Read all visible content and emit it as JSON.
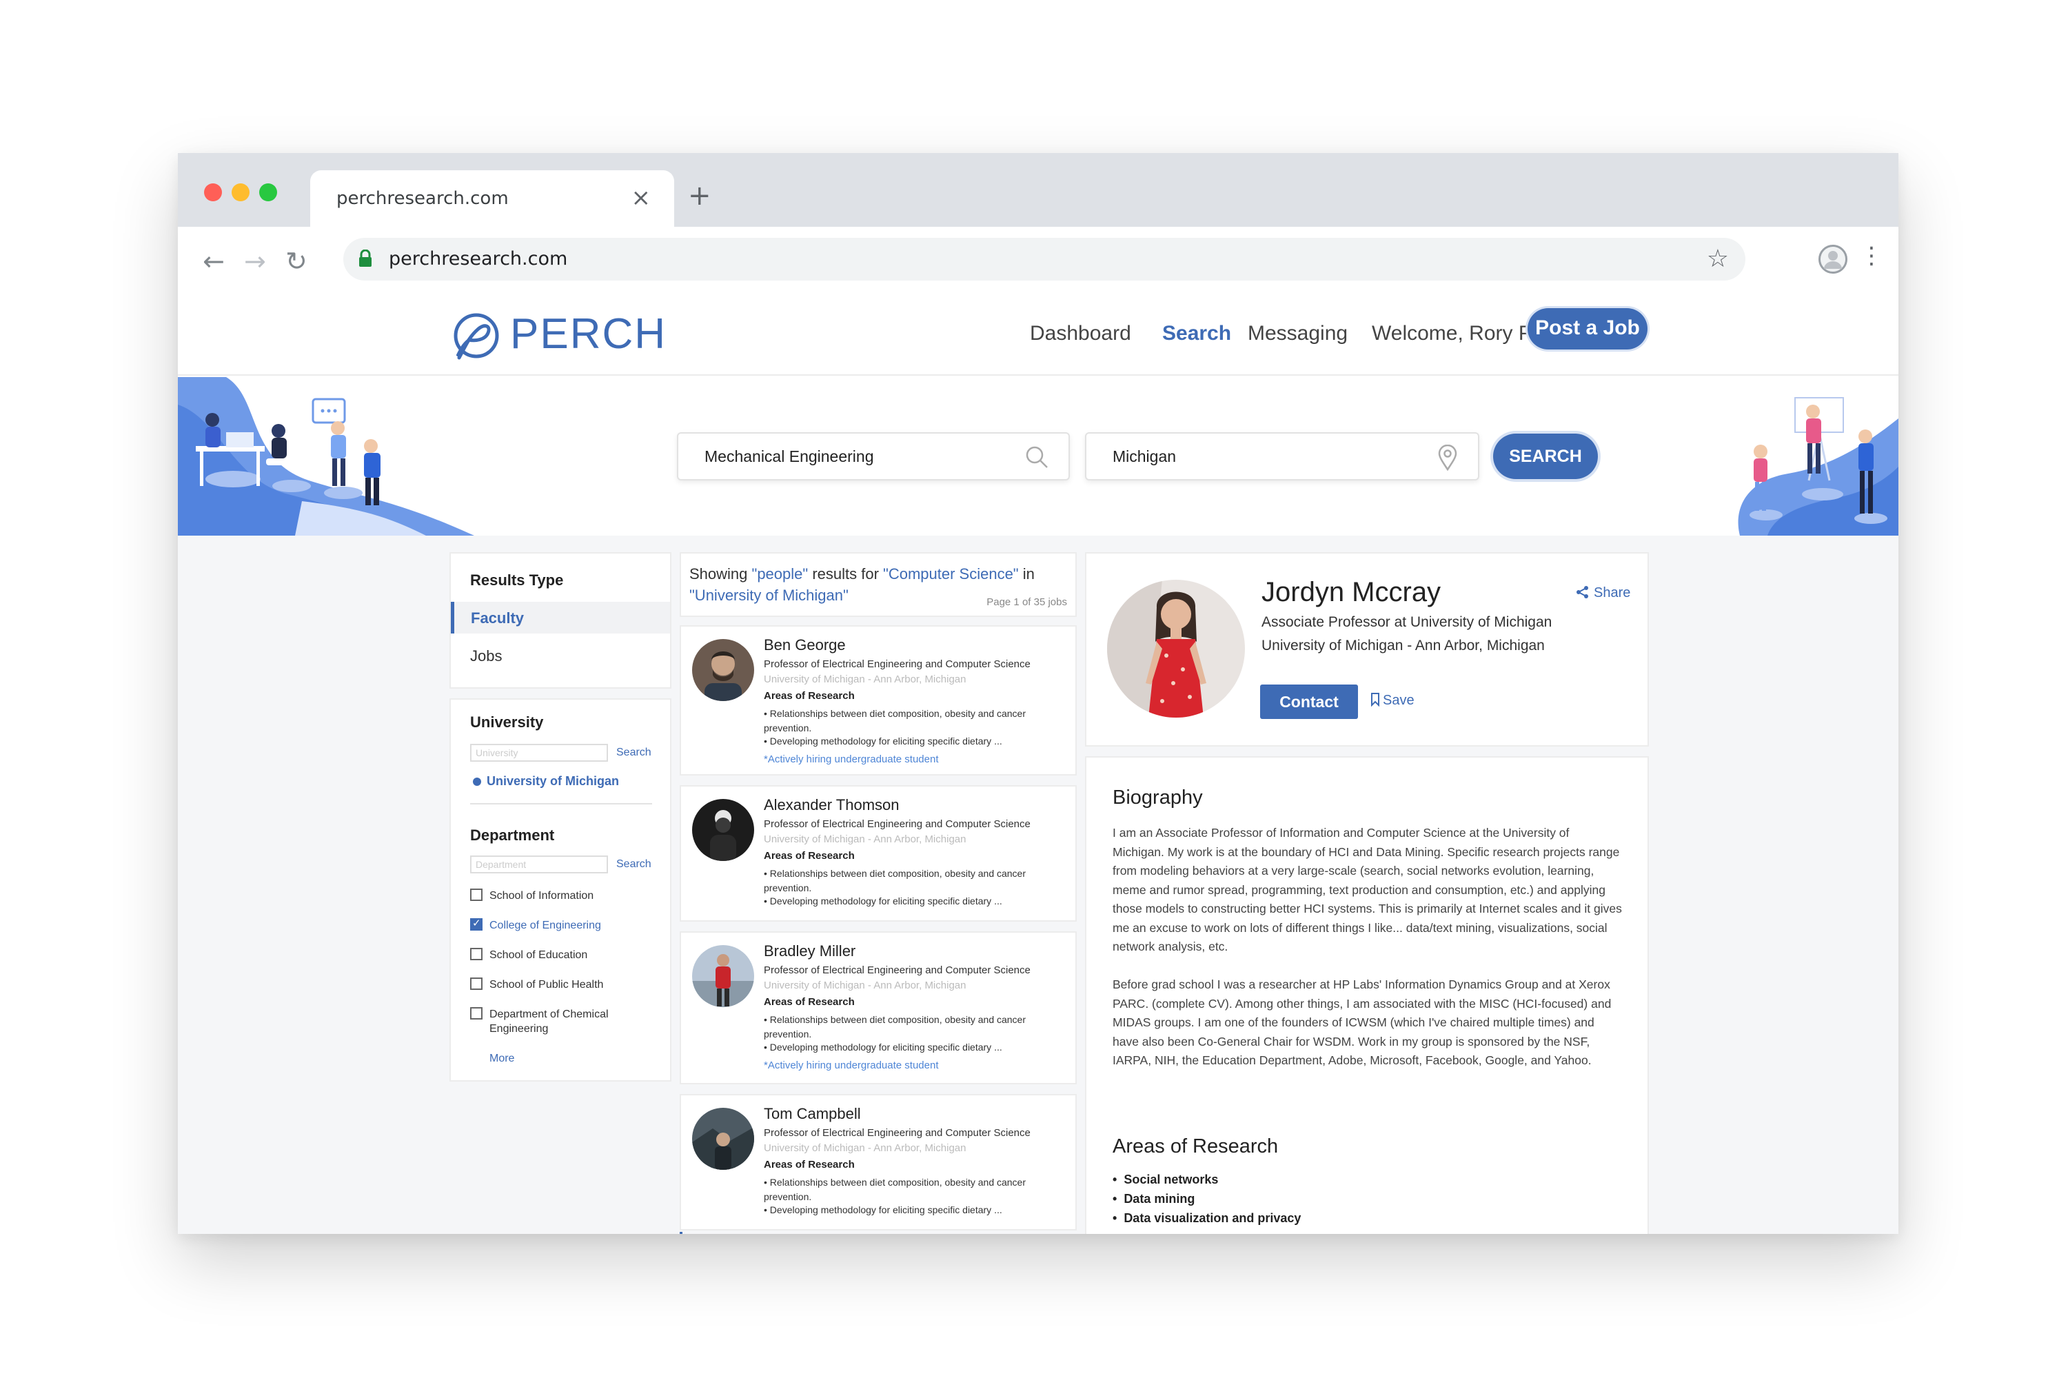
{
  "browser": {
    "tab_title": "perchresearch.com",
    "tab_close": "×",
    "new_tab": "+",
    "url": "perchresearch.com",
    "traffic_colors": [
      "#ff5f57",
      "#febc2e",
      "#28c840"
    ]
  },
  "header": {
    "logo_text": "PERCH",
    "nav": {
      "dashboard": "Dashboard",
      "search": "Search",
      "messaging": "Messaging",
      "welcome": "Welcome, Rory P..."
    },
    "post_job": "Post a Job",
    "accent_color": "#3e6bb5"
  },
  "hero": {
    "query_value": "Mechanical Engineering",
    "location_value": "Michigan",
    "search_button": "SEARCH"
  },
  "filters": {
    "results_type": {
      "title": "Results Type",
      "options": [
        "Faculty",
        "Jobs"
      ],
      "selected": "Faculty"
    },
    "university": {
      "title": "University",
      "placeholder": "University",
      "search_link": "Search",
      "selected": "University of Michigan"
    },
    "department": {
      "title": "Department",
      "placeholder": "Department",
      "search_link": "Search",
      "options": [
        {
          "label": "School of Information",
          "checked": false
        },
        {
          "label": "College of Engineering",
          "checked": true
        },
        {
          "label": "School of Education",
          "checked": false
        },
        {
          "label": "School of Public Health",
          "checked": false
        },
        {
          "label": "Department of Chemical Engineering",
          "checked": false
        }
      ],
      "more": "More"
    }
  },
  "results": {
    "prefix": "Showing ",
    "type": "\"people\"",
    "mid": " results for ",
    "query": "\"Computer Science\"",
    "in": " in ",
    "place": "\"University of Michigan\"",
    "page": "Page 1 of 35 jobs",
    "items": [
      {
        "name": "Ben George",
        "title": "Professor of Electrical Engineering and Computer Science",
        "location": "University of Michigan - Ann Arbor, Michigan",
        "areas_label": "Areas of Research",
        "bullet1": "• Relationships between diet composition, obesity and cancer prevention.",
        "bullet2": "• Developing methodology for eliciting specific dietary ...",
        "hiring": "*Actively hiring undergraduate student"
      },
      {
        "name": "Alexander Thomson",
        "title": "Professor of Electrical Engineering and Computer Science",
        "location": "University of Michigan - Ann Arbor, Michigan",
        "areas_label": "Areas of Research",
        "bullet1": "• Relationships between diet composition, obesity and cancer prevention.",
        "bullet2": "• Developing methodology for eliciting specific dietary ...",
        "hiring": ""
      },
      {
        "name": "Bradley Miller",
        "title": "Professor of Electrical Engineering and Computer Science",
        "location": "University of Michigan - Ann Arbor, Michigan",
        "areas_label": "Areas of Research",
        "bullet1": "• Relationships between diet composition, obesity and cancer prevention.",
        "bullet2": "• Developing methodology for eliciting specific dietary ...",
        "hiring": "*Actively hiring undergraduate student"
      },
      {
        "name": "Tom Campbell",
        "title": "Professor of Electrical Engineering and Computer Science",
        "location": "University of Michigan - Ann Arbor, Michigan",
        "areas_label": "Areas of Research",
        "bullet1": "• Relationships between diet composition, obesity and cancer prevention.",
        "bullet2": "• Developing methodology for eliciting specific dietary ...",
        "hiring": ""
      }
    ]
  },
  "profile": {
    "name": "Jordyn Mccray",
    "title": "Associate Professor at University of Michigan",
    "location": "University of Michigan - Ann Arbor, Michigan",
    "share": "Share",
    "contact": "Contact",
    "save": "Save",
    "bio_heading": "Biography",
    "bio_p1": "I am an Associate Professor of Information and Computer Science at the University of Michigan. My work is at the boundary of HCI and Data Mining. Specific research projects range from modeling behaviors at a very large-scale (search, social networks evolution, learning, meme and rumor spread, programming, text production and consumption, etc.) and applying those models to constructing better HCI systems. This is primarily at Internet scales and it gives me an excuse to work on lots of different things I like... data/text mining, visualizations, social network analysis, etc.",
    "bio_p2": "Before grad school I was a researcher at HP Labs' Information Dynamics Group and at Xerox PARC. (complete CV). Among other things, I am associated with the MISC (HCI-focused) and MIDAS groups. I am one of the founders of ICWSM (which I've chaired multiple times) and have also been Co-General Chair for WSDM. Work in my group is sponsored by the NSF, IARPA, NIH, the Education Department, Adobe, Microsoft, Facebook, Google, and Yahoo.",
    "areas_heading": "Areas of Research",
    "areas": [
      "Social networks",
      "Data mining",
      "Data visualization and privacy"
    ]
  }
}
